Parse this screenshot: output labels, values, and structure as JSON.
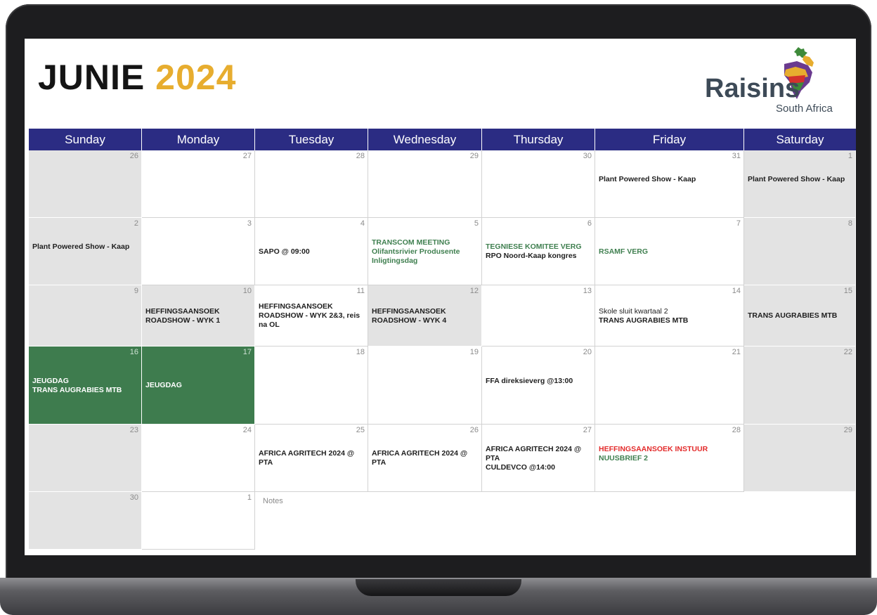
{
  "header": {
    "month": "JUNIE",
    "year": "2024",
    "logo_word": "Raisins",
    "logo_sub": "South Africa"
  },
  "colors": {
    "header_bg": "#2b2c83",
    "accent_year": "#e7ad2f",
    "holiday_bg": "#3e7c4e",
    "weekend_bg": "#e3e3e3",
    "green_text": "#3f7f4f",
    "red_text": "#e32b2b"
  },
  "days": [
    "Sunday",
    "Monday",
    "Tuesday",
    "Wednesday",
    "Thursday",
    "Friday",
    "Saturday"
  ],
  "notes_label": "Notes",
  "weeks": [
    [
      {
        "num": "26",
        "kind": "we",
        "events": []
      },
      {
        "num": "27",
        "kind": "",
        "events": []
      },
      {
        "num": "28",
        "kind": "",
        "events": []
      },
      {
        "num": "29",
        "kind": "",
        "events": []
      },
      {
        "num": "30",
        "kind": "",
        "events": []
      },
      {
        "num": "31",
        "kind": "",
        "events": [
          {
            "text": "Plant Powered Show - Kaap",
            "style": "bold"
          }
        ]
      },
      {
        "num": "1",
        "kind": "we",
        "events": [
          {
            "text": "Plant Powered Show - Kaap",
            "style": "bold"
          }
        ]
      }
    ],
    [
      {
        "num": "2",
        "kind": "we",
        "events": [
          {
            "text": "Plant Powered Show - Kaap",
            "style": "bold"
          }
        ]
      },
      {
        "num": "3",
        "kind": "",
        "events": []
      },
      {
        "num": "4",
        "kind": "",
        "events": [
          {
            "text": "SAPO @ 09:00",
            "style": "bold"
          }
        ]
      },
      {
        "num": "5",
        "kind": "",
        "events": [
          {
            "text": "TRANSCOM MEETING",
            "style": "green"
          },
          {
            "text": "Olifantsrivier Produsente Inligtingsdag",
            "style": "green"
          }
        ]
      },
      {
        "num": "6",
        "kind": "",
        "events": [
          {
            "text": "TEGNIESE KOMITEE VERG",
            "style": "green"
          },
          {
            "text": "RPO Noord-Kaap kongres",
            "style": "bold"
          }
        ]
      },
      {
        "num": "7",
        "kind": "",
        "events": [
          {
            "text": "RSAMF VERG",
            "style": "green"
          }
        ]
      },
      {
        "num": "8",
        "kind": "we",
        "events": []
      }
    ],
    [
      {
        "num": "9",
        "kind": "we",
        "events": []
      },
      {
        "num": "10",
        "kind": "we",
        "events": [
          {
            "text": "HEFFINGSAANSOEK ROADSHOW - WYK 1",
            "style": "bold"
          }
        ]
      },
      {
        "num": "11",
        "kind": "",
        "events": [
          {
            "text": "HEFFINGSAANSOEK ROADSHOW - WYK 2&3, reis na OL",
            "style": "bold"
          }
        ]
      },
      {
        "num": "12",
        "kind": "we",
        "events": [
          {
            "text": "HEFFINGSAANSOEK ROADSHOW - WYK 4",
            "style": "bold"
          }
        ]
      },
      {
        "num": "13",
        "kind": "",
        "events": []
      },
      {
        "num": "14",
        "kind": "",
        "events": [
          {
            "text": "Skole sluit kwartaal 2",
            "style": "light"
          },
          {
            "text": "TRANS AUGRABIES MTB",
            "style": "bold"
          }
        ]
      },
      {
        "num": "15",
        "kind": "we",
        "events": [
          {
            "text": "TRANS AUGRABIES MTB",
            "style": "bold"
          }
        ]
      }
    ],
    [
      {
        "num": "16",
        "kind": "hol",
        "events": [
          {
            "text": "JEUGDAG",
            "style": "white"
          },
          {
            "text": "TRANS AUGRABIES MTB",
            "style": "white"
          }
        ]
      },
      {
        "num": "17",
        "kind": "hol",
        "events": [
          {
            "text": "JEUGDAG",
            "style": "white"
          }
        ]
      },
      {
        "num": "18",
        "kind": "",
        "events": []
      },
      {
        "num": "19",
        "kind": "",
        "events": []
      },
      {
        "num": "20",
        "kind": "",
        "events": [
          {
            "text": "FFA direksieverg @13:00",
            "style": "bold"
          }
        ]
      },
      {
        "num": "21",
        "kind": "",
        "events": []
      },
      {
        "num": "22",
        "kind": "we",
        "events": []
      }
    ],
    [
      {
        "num": "23",
        "kind": "we",
        "events": []
      },
      {
        "num": "24",
        "kind": "",
        "events": []
      },
      {
        "num": "25",
        "kind": "",
        "events": [
          {
            "text": "AFRICA AGRITECH 2024 @ PTA",
            "style": "bold"
          }
        ]
      },
      {
        "num": "26",
        "kind": "",
        "events": [
          {
            "text": "AFRICA AGRITECH 2024 @ PTA",
            "style": "bold"
          }
        ]
      },
      {
        "num": "27",
        "kind": "",
        "events": [
          {
            "text": "AFRICA AGRITECH 2024 @ PTA",
            "style": "bold"
          },
          {
            "text": "CULDEVCO @14:00",
            "style": "bold"
          }
        ]
      },
      {
        "num": "28",
        "kind": "",
        "events": [
          {
            "text": "HEFFINGSAANSOEK INSTUUR",
            "style": "red"
          },
          {
            "text": "NUUSBRIEF 2",
            "style": "green"
          }
        ]
      },
      {
        "num": "29",
        "kind": "we",
        "events": []
      }
    ],
    [
      {
        "num": "30",
        "kind": "we",
        "events": []
      },
      {
        "num": "1",
        "kind": "",
        "events": []
      }
    ]
  ]
}
